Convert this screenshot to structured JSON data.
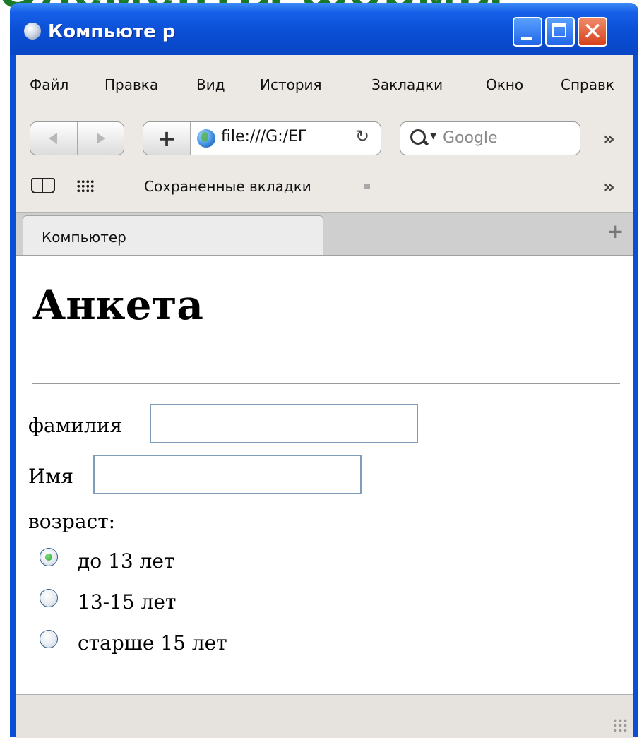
{
  "background_heading": "Элементы формы",
  "window": {
    "title": "Компьюте р"
  },
  "menu": [
    "Файл",
    "Правка",
    "Вид",
    "История",
    "Закладки",
    "Окно",
    "Справк"
  ],
  "address_bar": {
    "url": "file:///G:/EГ"
  },
  "search": {
    "placeholder": "Google"
  },
  "bookmarks_bar": {
    "saved_tabs_label": "Сохраненные вкладки"
  },
  "tabs": [
    {
      "label": "Компьютер",
      "active": true
    }
  ],
  "page": {
    "heading": "Анкета",
    "fields": [
      {
        "label": "фамилия",
        "value": ""
      },
      {
        "label": "Имя",
        "value": ""
      }
    ],
    "age_label": "возраст:",
    "age_options": [
      {
        "label": "до 13 лет",
        "checked": true
      },
      {
        "label": "13-15 лет",
        "checked": false
      },
      {
        "label": "старше 15 лет",
        "checked": false
      }
    ]
  },
  "colors": {
    "titlebar": "#0a4fd6",
    "background_heading": "#1b7a2a",
    "input_border": "#7f9db9"
  }
}
